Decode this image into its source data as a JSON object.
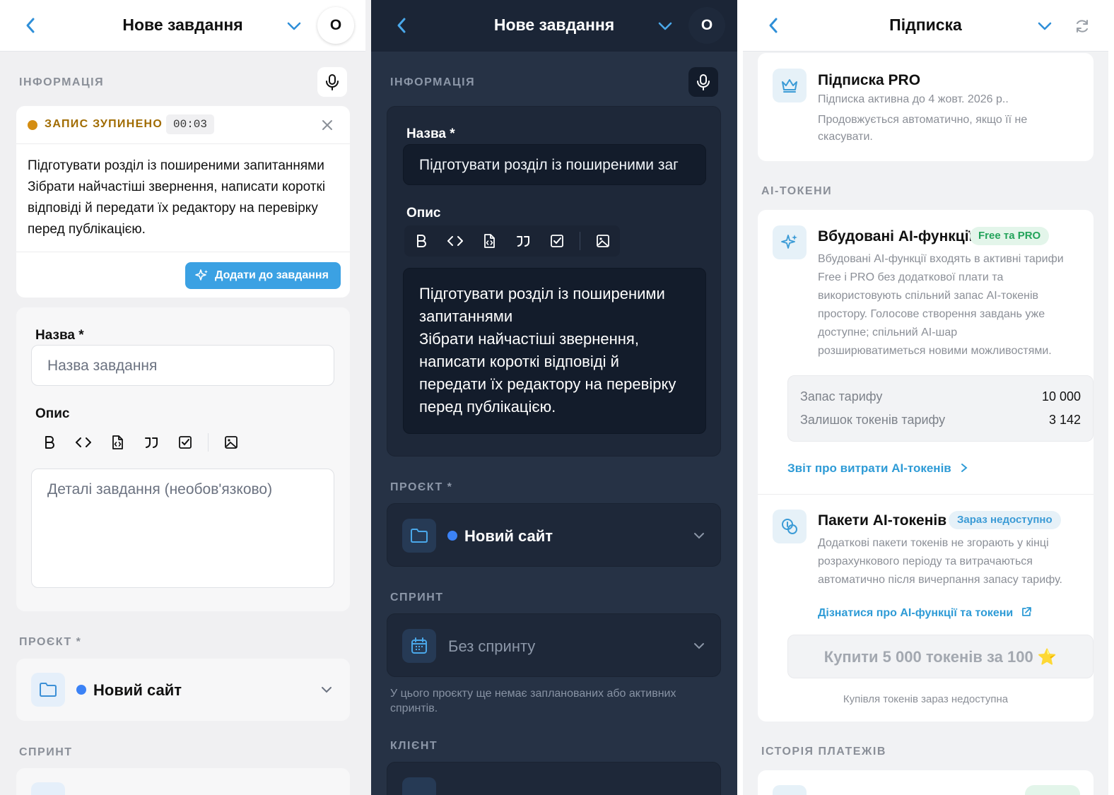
{
  "panel_left": {
    "header": {
      "title": "Нове завдання",
      "avatar_letter": "О"
    },
    "info_label": "ІНФОРМАЦІЯ",
    "recording": {
      "status": "ЗАПИС ЗУПИНЕНО",
      "timer": "00:03",
      "transcript_lines": [
        "Підготувати розділ із поширеними запитаннями",
        "Зібрати найчастіші звернення, написати короткі",
        "відповіді й передати їх редактору на перевірку",
        "перед публікацією."
      ],
      "add_button": "Додати до завдання"
    },
    "form": {
      "name_label": "Назва *",
      "name_placeholder": "Назва завдання",
      "desc_label": "Опис",
      "desc_placeholder": "Деталі завдання (необов'язково)"
    },
    "project_label": "ПРОЄКТ *",
    "project_value": "Новий сайт",
    "project_dot_color": "#3b82f6",
    "sprint_label": "СПРИНТ"
  },
  "panel_middle": {
    "header": {
      "title": "Нове завдання",
      "avatar_letter": "О"
    },
    "info_label": "ІНФОРМАЦІЯ",
    "form": {
      "name_label": "Назва *",
      "name_value": "Підготувати розділ із поширеними заг",
      "desc_label": "Опис",
      "desc_lines": [
        "Підготувати розділ із поширеними",
        "запитаннями",
        "Зібрати найчастіші звернення,",
        "написати короткі відповіді й",
        "передати їх редактору на перевірку",
        "перед публікацією."
      ]
    },
    "project_label": "ПРОЄКТ *",
    "project_value": "Новий сайт",
    "sprint_label": "СПРИНТ",
    "sprint_value": "Без спринту",
    "sprint_note_lines": [
      "У цього проєкту ще немає запланованих або активних",
      "спринтів."
    ],
    "client_label": "КЛІЄНТ"
  },
  "panel_right": {
    "header": {
      "title": "Підписка"
    },
    "subscription": {
      "title": "Підписка PRO",
      "active_until": "Підписка активна до 4 жовт. 2026 р..",
      "renew_lines": [
        "Продовжується автоматично, якщо її не",
        "скасувати."
      ]
    },
    "ai_tokens_label": "AI-ТОКЕНИ",
    "builtin": {
      "title": "Вбудовані AI-функції",
      "badge": "Free та PRO",
      "desc_lines": [
        "Вбудовані AI-функції входять в активні тарифи",
        "Free і PRO без додаткової плати та",
        "використовують спільний запас AI-токенів",
        "простору. Голосове створення завдань уже",
        "доступне; спільний AI-шар",
        "розширюватиметься новими можливостями."
      ],
      "quota_label": "Запас тарифу",
      "quota_value": "10 000",
      "remaining_label": "Залишок токенів тарифу",
      "remaining_value": "3 142",
      "report_link": "Звіт про витрати AI-токенів"
    },
    "packages": {
      "title": "Пакети AI-токенів",
      "badge": "Зараз недоступно",
      "desc_lines": [
        "Додаткові пакети токенів не згорають у кінці",
        "розрахункового періоду та витрачаються",
        "автоматично після вичерпання запасу тарифу."
      ],
      "learn_link": "Дізнатися про AI-функції та токени",
      "buy_button": "Купити 5 000 токенів за 100 ⭐",
      "buy_note": "Купівля токенів зараз недоступна"
    },
    "history_label": "ІСТОРІЯ ПЛАТЕЖІВ"
  }
}
